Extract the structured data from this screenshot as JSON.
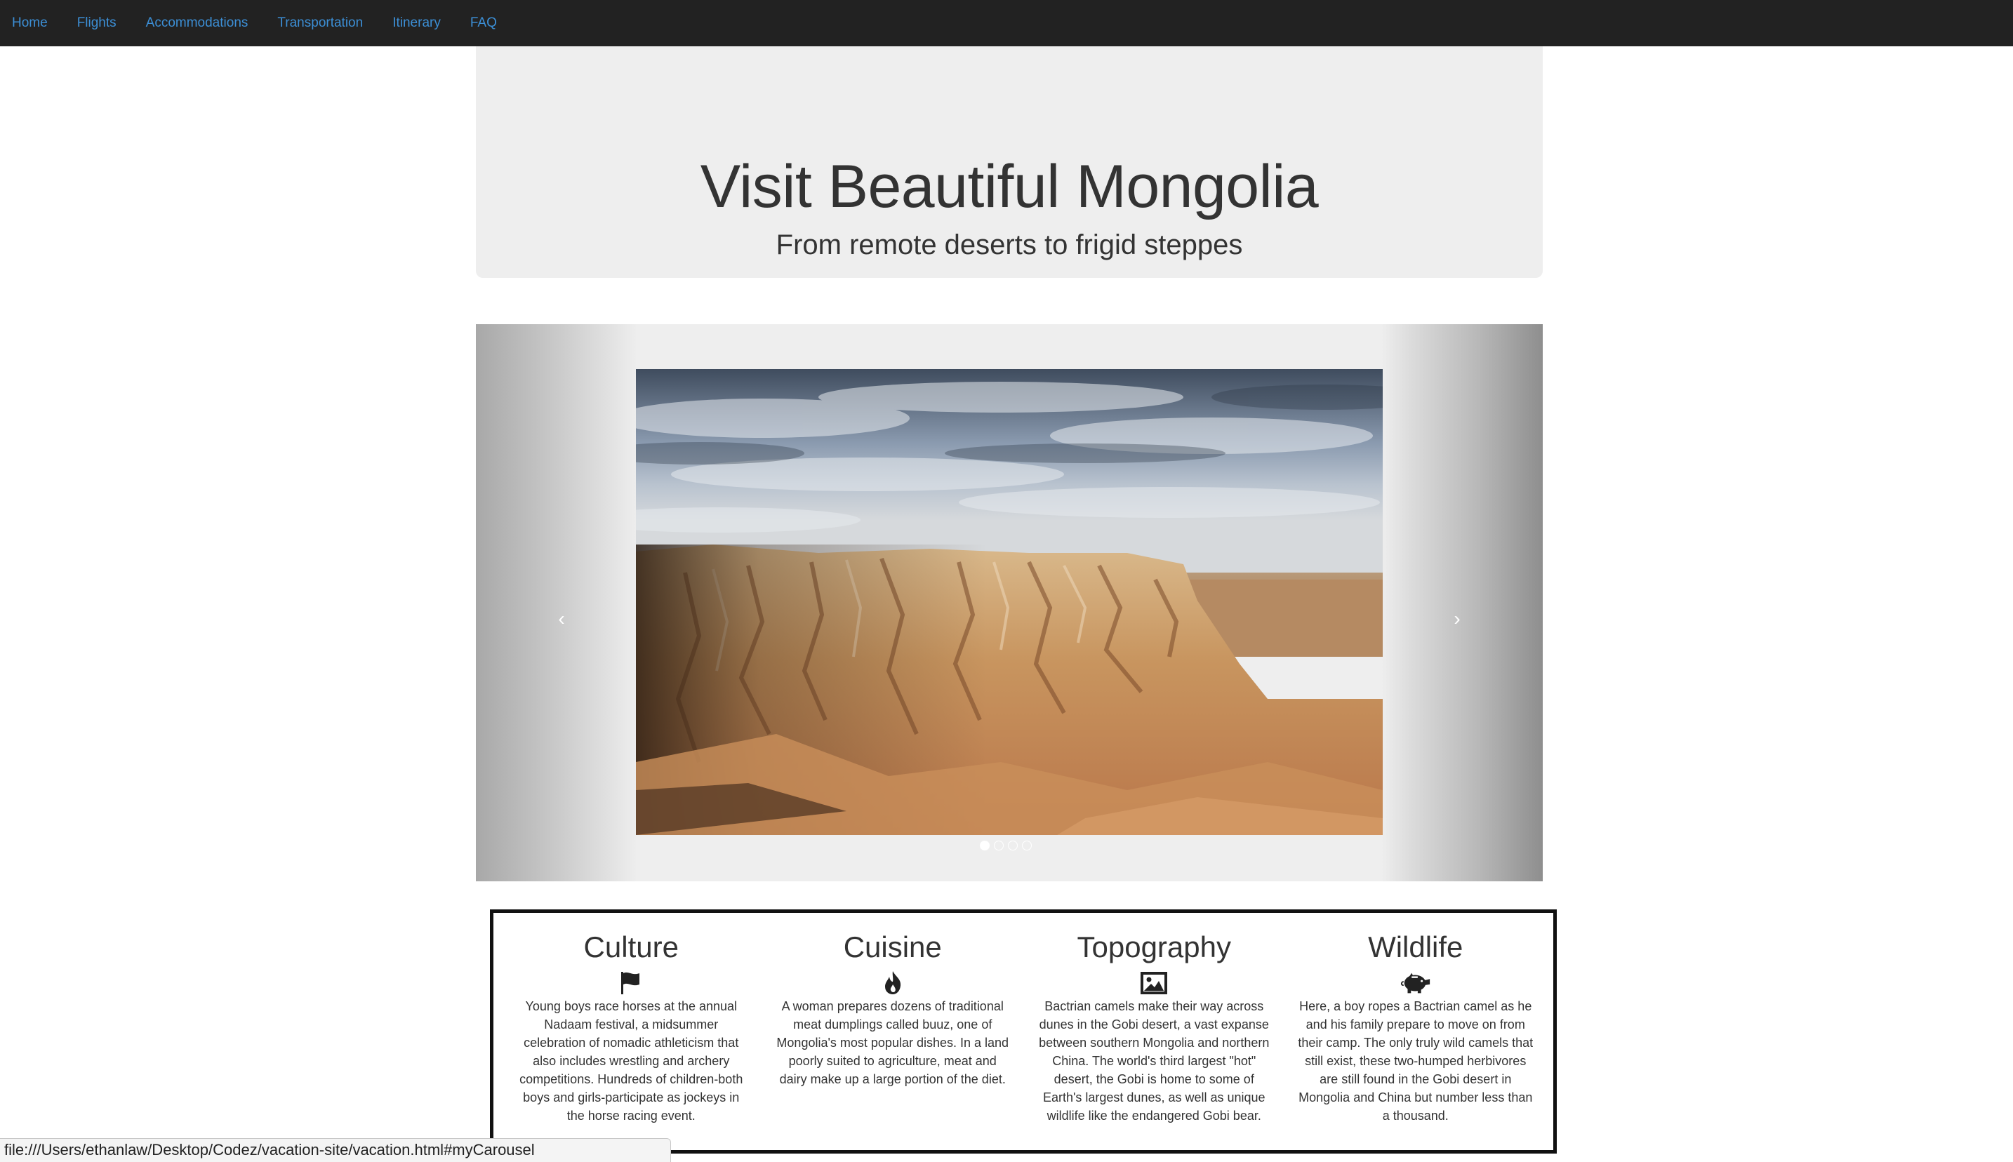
{
  "nav": {
    "items": [
      {
        "label": "Home"
      },
      {
        "label": "Flights"
      },
      {
        "label": "Accommodations"
      },
      {
        "label": "Transportation"
      },
      {
        "label": "Itinerary"
      },
      {
        "label": "FAQ"
      }
    ],
    "link_color": "#3c8fd6",
    "background": "#222222"
  },
  "jumbotron": {
    "title": "Visit Beautiful Mongolia",
    "subtitle": "From remote deserts to frigid steppes"
  },
  "carousel": {
    "prev_glyph": "‹",
    "next_glyph": "›",
    "slide_count": 4,
    "active_slide": 1,
    "image_subject": "Gobi desert eroded sandstone cliffs under cloudy sky"
  },
  "features": [
    {
      "title": "Culture",
      "icon": "flag-icon",
      "text": "Young boys race horses at the annual Nadaam festival, a midsummer celebration of nomadic athleticism that also includes wrestling and archery competitions. Hundreds of children-both boys and girls-participate as jockeys in the horse racing event."
    },
    {
      "title": "Cuisine",
      "icon": "fire-icon",
      "text": "A woman prepares dozens of traditional meat dumplings called buuz, one of Mongolia's most popular dishes. In a land poorly suited to agriculture, meat and dairy make up a large portion of the diet."
    },
    {
      "title": "Topography",
      "icon": "picture-icon",
      "text": "Bactrian camels make their way across dunes in the Gobi desert, a vast expanse between southern Mongolia and northern China. The world's third largest \"hot\" desert, the Gobi is home to some of Earth's largest dunes, as well as unique wildlife like the endangered Gobi bear."
    },
    {
      "title": "Wildlife",
      "icon": "piggy-bank-icon",
      "text": "Here, a boy ropes a Bactrian camel as he and his family prepare to move on from their camp. The only truly wild camels that still exist, these two-humped herbivores are still found in the Gobi desert in Mongolia and China but number less than a thousand."
    }
  ],
  "status_bar": {
    "url": "file:///Users/ethanlaw/Desktop/Codez/vacation-site/vacation.html#myCarousel"
  }
}
